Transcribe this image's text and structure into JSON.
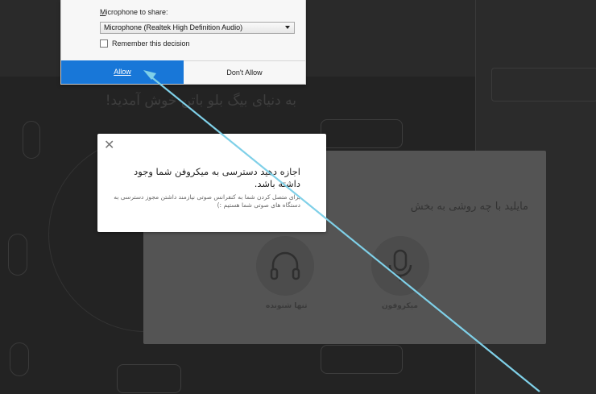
{
  "permission_dialog": {
    "microphone_label": "Microphone to share:",
    "microphone_label_accesskey": "M",
    "selected_device": "Microphone (Realtek High Definition Audio)",
    "remember_label": "Remember this decision",
    "remember_checked": false,
    "allow_label": "Allow",
    "dont_allow_label": "Don't Allow"
  },
  "toast": {
    "title": "اجازه دهید دسترسی به میکروفن شما وجود داشته باشد.",
    "body": "برای متصل کردن شما به کنفرانس صوتی نیازمند داشتن مجوز دسترسی به دستگاه های صوتی شما هستیم :)"
  },
  "audio_modal": {
    "title": "مایلید با چه روشی به بخش",
    "options": [
      {
        "label": "تنها شنونده",
        "icon": "headphones-icon"
      },
      {
        "label": "میکروفون",
        "icon": "microphone-icon"
      }
    ]
  },
  "background": {
    "welcome": "به دنیای بیگ بلو باتن خوش آمدید!"
  },
  "colors": {
    "allow_button": "#1877d8",
    "annotation_arrow": "#7fd0e8"
  }
}
